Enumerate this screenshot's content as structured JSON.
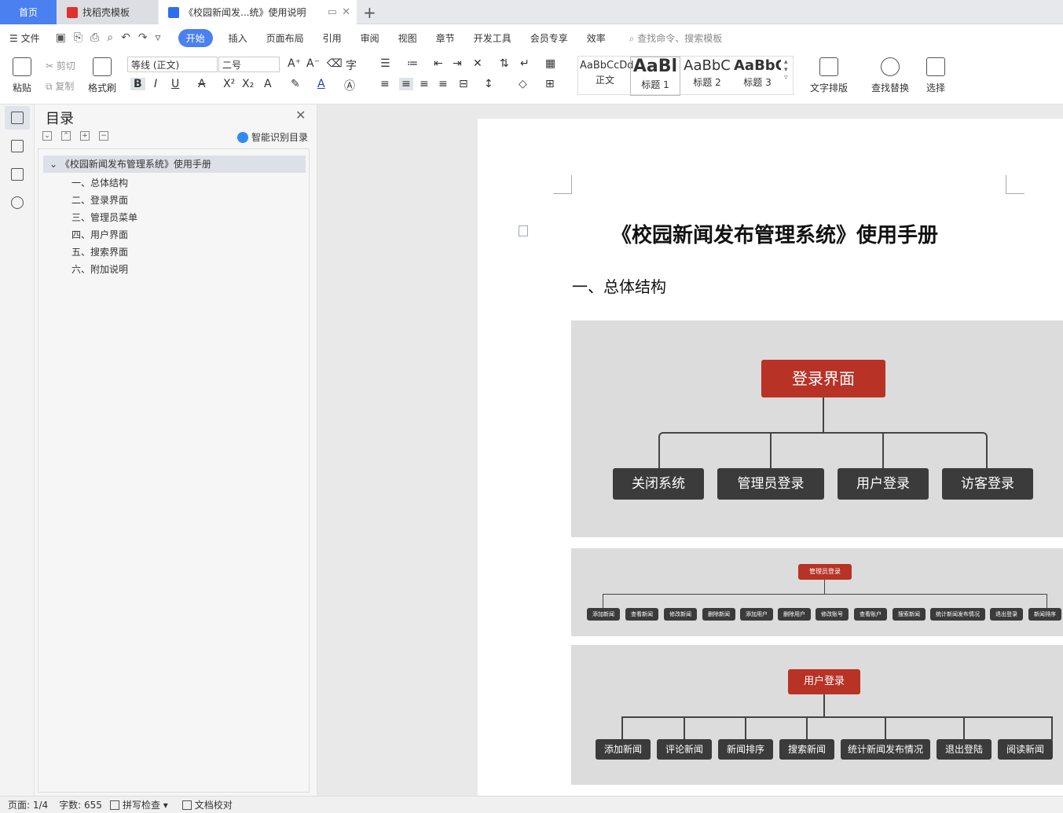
{
  "tabs": {
    "home": "首页",
    "template": "找稻壳模板",
    "document": "《校园新闻发...统》使用说明",
    "new_tab": "+"
  },
  "menu": {
    "file": "文件",
    "items": [
      "开始",
      "插入",
      "页面布局",
      "引用",
      "审阅",
      "视图",
      "章节",
      "开发工具",
      "会员专享",
      "效率"
    ],
    "active": "开始",
    "search": "查找命令、搜索模板"
  },
  "ribbon": {
    "paste": "粘贴",
    "cut": "剪切",
    "copy": "复制",
    "format_painter": "格式刷",
    "font_name": "等线 (正文)",
    "font_size": "二号",
    "styles": [
      {
        "sample": "AaBbCcDd",
        "label": "正文"
      },
      {
        "sample": "AaBl",
        "label": "标题 1"
      },
      {
        "sample": "AaBbC",
        "label": "标题 2"
      },
      {
        "sample": "AaBbC",
        "label": "标题 3"
      }
    ],
    "text_layout": "文字排版",
    "find_replace": "查找替换",
    "select": "选择"
  },
  "toc": {
    "title": "目录",
    "smart": "智能识别目录",
    "root": "《校园新闻发布管理系统》使用手册",
    "items": [
      "一、总体结构",
      "二、登录界面",
      "三、管理员菜单",
      "四、用户界面",
      "五、搜索界面",
      "六、附加说明"
    ]
  },
  "document": {
    "title": "《校园新闻发布管理系统》使用手册",
    "heading1": "一、总体结构",
    "diagram1": {
      "root": "登录界面",
      "children": [
        "关闭系统",
        "管理员登录",
        "用户登录",
        "访客登录"
      ]
    },
    "diagram2": {
      "root": "管理员登录",
      "children": [
        "添加新闻",
        "查看新闻",
        "修改新闻",
        "删除新闻",
        "添加用户",
        "删除用户",
        "修改账号",
        "查看账户",
        "搜索新闻",
        "统计新闻发布情况",
        "退出登录",
        "新闻排序"
      ]
    },
    "diagram3": {
      "root": "用户登录",
      "children": [
        "添加新闻",
        "评论新闻",
        "新闻排序",
        "搜索新闻",
        "统计新闻发布情况",
        "退出登陆",
        "阅读新闻"
      ]
    }
  },
  "status": {
    "page": "页面: 1/4",
    "words": "字数: 655",
    "spell": "拼写检查",
    "proof": "文档校对"
  }
}
